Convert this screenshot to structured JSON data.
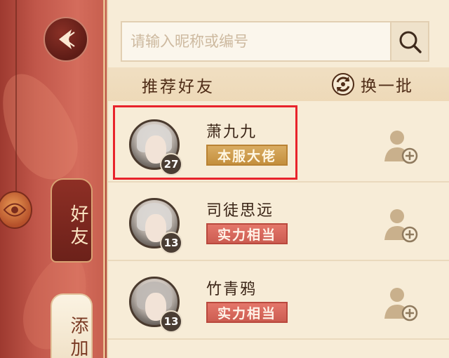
{
  "search": {
    "placeholder": "请输入昵称或编号",
    "value": "",
    "icon": "search-icon"
  },
  "sidebar": {
    "back_icon": "back-arrow-icon",
    "tabs": [
      {
        "label": "好友",
        "selected": true
      },
      {
        "label": "添加",
        "selected": false
      }
    ]
  },
  "header": {
    "title": "推荐好友",
    "refresh_label": "换一批",
    "refresh_icon": "refresh-icon"
  },
  "friends": [
    {
      "name": "萧九九",
      "level": "27",
      "badge": "本服大佬",
      "badge_color": "#c48f3d",
      "action_icon": "add-friend-icon"
    },
    {
      "name": "司徒思远",
      "level": "13",
      "badge": "实力相当",
      "badge_color": "#cc5d51",
      "action_icon": "add-friend-icon"
    },
    {
      "name": "竹青鸦",
      "level": "13",
      "badge": "实力相当",
      "badge_color": "#cc5d51",
      "action_icon": "add-friend-icon"
    }
  ],
  "colors": {
    "sidebar": "#b44a3c",
    "panel": "#f7ecd7",
    "highlight": "#e8232b"
  }
}
